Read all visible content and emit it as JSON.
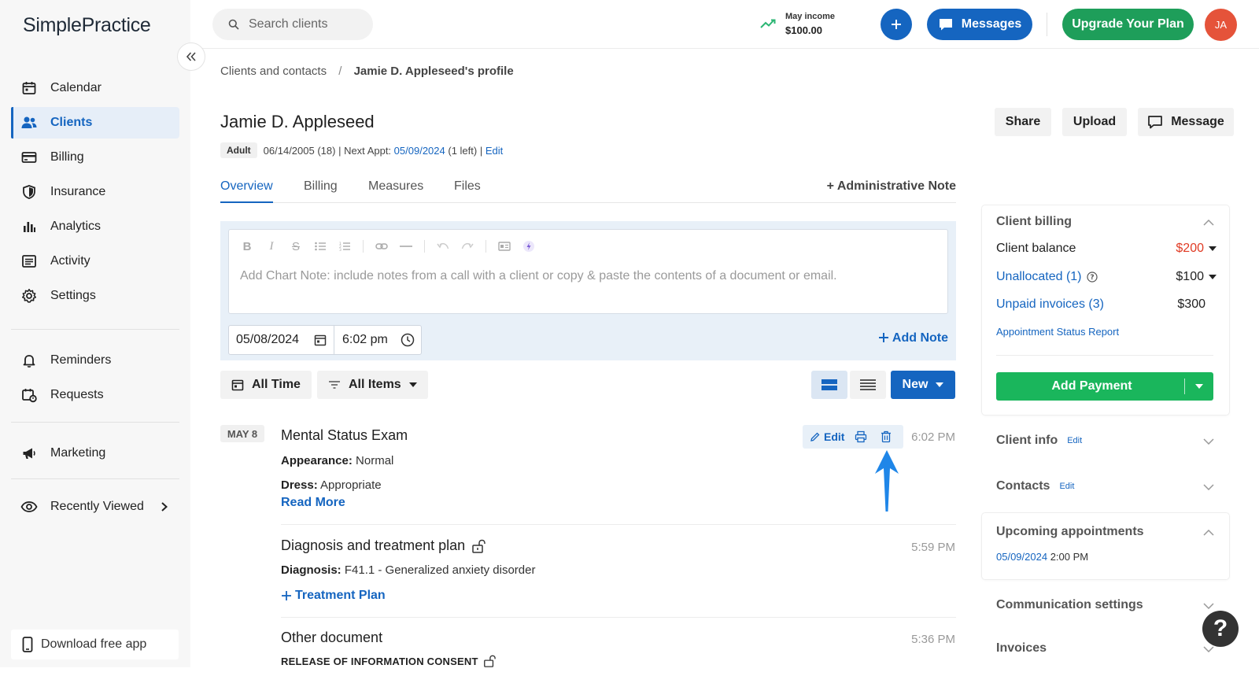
{
  "app": {
    "logo": "SimplePractice"
  },
  "sidebar": {
    "items": [
      {
        "label": "Calendar",
        "icon": "calendar-icon"
      },
      {
        "label": "Clients",
        "icon": "users-icon",
        "active": true
      },
      {
        "label": "Billing",
        "icon": "credit-card-icon"
      },
      {
        "label": "Insurance",
        "icon": "shield-icon"
      },
      {
        "label": "Analytics",
        "icon": "bar-chart-icon"
      },
      {
        "label": "Activity",
        "icon": "list-icon"
      },
      {
        "label": "Settings",
        "icon": "gear-icon"
      },
      {
        "label": "Reminders",
        "icon": "bell-icon"
      },
      {
        "label": "Requests",
        "icon": "calendar-request-icon"
      },
      {
        "label": "Marketing",
        "icon": "megaphone-icon"
      },
      {
        "label": "Recently Viewed",
        "icon": "eye-icon"
      }
    ],
    "download_label": "Download free app"
  },
  "topbar": {
    "search_placeholder": "Search clients",
    "income_label": "May income",
    "income_value": "$100.00",
    "messages_label": "Messages",
    "upgrade_label": "Upgrade Your Plan",
    "avatar_initials": "JA"
  },
  "breadcrumb": {
    "parent": "Clients and contacts",
    "separator": "/",
    "current": "Jamie D. Appleseed's profile"
  },
  "client": {
    "name": "Jamie D. Appleseed",
    "badge": "Adult",
    "dob": "06/14/2005 (18)",
    "next_appt_label": "| Next Appt:",
    "next_appt_date": "05/09/2024",
    "next_appt_suffix": "(1 left) |",
    "edit_label": "Edit"
  },
  "header_buttons": {
    "share": "Share",
    "upload": "Upload",
    "message": "Message"
  },
  "tabs": [
    {
      "label": "Overview",
      "active": true
    },
    {
      "label": "Billing"
    },
    {
      "label": "Measures"
    },
    {
      "label": "Files"
    }
  ],
  "admin_note_label": "+ Administrative Note",
  "editor": {
    "placeholder": "Add Chart Note: include notes from a call with a client or copy & paste the contents of a document or email.",
    "date": "05/08/2024",
    "time": "6:02 pm",
    "add_note_label": "Add Note"
  },
  "filters": {
    "time_label": "All Time",
    "items_label": "All Items",
    "new_label": "New"
  },
  "timeline": {
    "date_badge": "MAY 8",
    "entries": [
      {
        "title": "Mental Status Exam",
        "time": "6:02 PM",
        "lines": [
          {
            "label": "Appearance:",
            "value": "Normal"
          },
          {
            "label": "Dress:",
            "value": "Appropriate"
          }
        ],
        "read_more": "Read More",
        "actions": {
          "edit": "Edit"
        }
      },
      {
        "title": "Diagnosis and treatment plan",
        "time": "5:59 PM",
        "lines": [
          {
            "label": "Diagnosis:",
            "value": "F41.1 - Generalized anxiety disorder"
          }
        ],
        "link": "Treatment Plan"
      },
      {
        "title": "Other document",
        "time": "5:36 PM",
        "subtitle": "RELEASE OF INFORMATION CONSENT"
      }
    ]
  },
  "right_panel": {
    "client_billing": {
      "title": "Client billing",
      "balance_label": "Client balance",
      "balance_value": "$200",
      "unallocated_label": "Unallocated (1)",
      "unallocated_value": "$100",
      "unpaid_label": "Unpaid invoices (3)",
      "unpaid_value": "$300",
      "report_link": "Appointment Status Report",
      "add_payment": "Add Payment"
    },
    "client_info": {
      "title": "Client info",
      "edit": "Edit"
    },
    "contacts": {
      "title": "Contacts",
      "edit": "Edit"
    },
    "upcoming": {
      "title": "Upcoming appointments",
      "date": "05/09/2024",
      "time": "2:00 PM"
    },
    "communication": {
      "title": "Communication settings"
    },
    "invoices": {
      "title": "Invoices"
    }
  },
  "help_label": "?",
  "colors": {
    "primary": "#1565c0",
    "success": "#1e9e5a",
    "payment": "#1ab65c",
    "danger": "#e03b24",
    "avatar": "#e5533a",
    "annotation_arrow": "#1f86e8"
  }
}
